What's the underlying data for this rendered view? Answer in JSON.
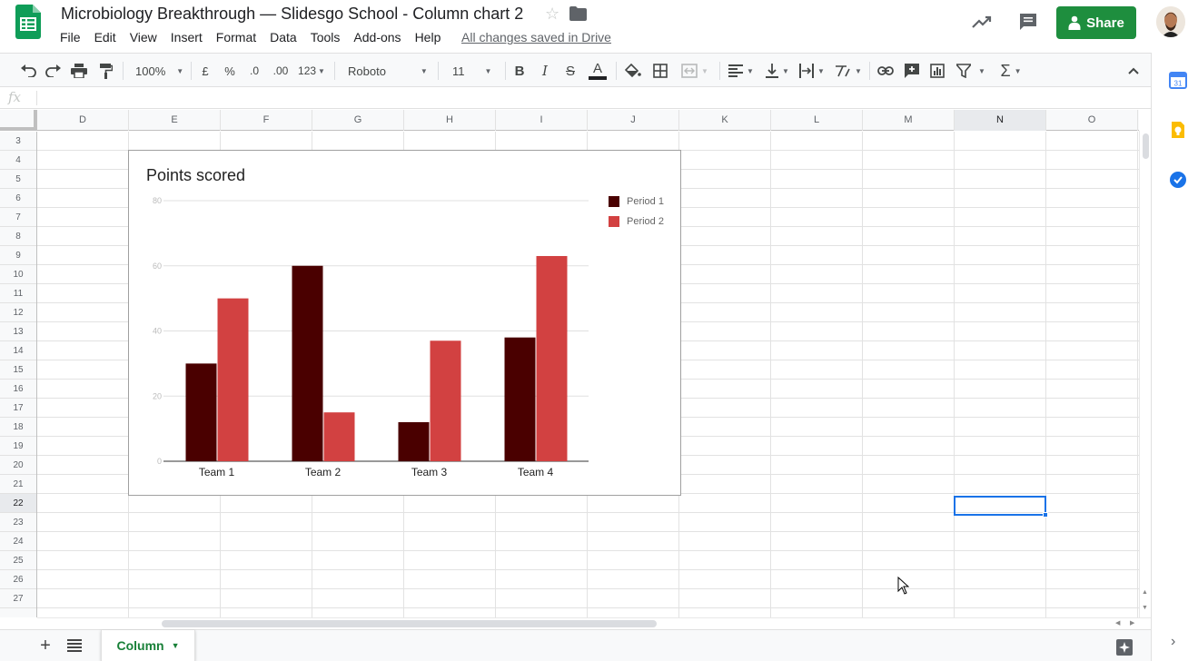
{
  "header": {
    "title": "Microbiology Breakthrough — Slidesgo School - Column chart 2",
    "menus": [
      "File",
      "Edit",
      "View",
      "Insert",
      "Format",
      "Data",
      "Tools",
      "Add-ons",
      "Help"
    ],
    "saved_status": "All changes saved in Drive",
    "share_label": "Share"
  },
  "toolbar": {
    "zoom": "100%",
    "currency": "£",
    "percent": "%",
    "decrease_decimals": ".0",
    "increase_decimals": ".00",
    "more_formats": "123",
    "font": "Roboto",
    "font_size": "11",
    "bold": "B",
    "italic": "I",
    "strikethrough": "S",
    "text_color": "A"
  },
  "formula_bar": {
    "fx": "fx",
    "value": ""
  },
  "columns": [
    "D",
    "E",
    "F",
    "G",
    "H",
    "I",
    "J",
    "K",
    "L",
    "M",
    "N",
    "O"
  ],
  "selected_column": "N",
  "rows": [
    "3",
    "4",
    "5",
    "6",
    "7",
    "8",
    "9",
    "10",
    "11",
    "12",
    "13",
    "14",
    "15",
    "16",
    "17",
    "18",
    "19",
    "20",
    "21",
    "22",
    "23",
    "24",
    "25",
    "26",
    "27"
  ],
  "selected_row": "22",
  "chart_data": {
    "type": "bar",
    "title": "Points scored",
    "categories": [
      "Team 1",
      "Team 2",
      "Team 3",
      "Team 4"
    ],
    "series": [
      {
        "name": "Period 1",
        "values": [
          30,
          60,
          12,
          38
        ],
        "color": "#4a0000"
      },
      {
        "name": "Period 2",
        "values": [
          50,
          15,
          37,
          63
        ],
        "color": "#d24141"
      }
    ],
    "ylim": [
      0,
      80
    ],
    "yticks": [
      0,
      20,
      40,
      60,
      80
    ],
    "legend": "top-right",
    "grid": true
  },
  "sheet_tabs": [
    {
      "label": "Column",
      "active": true
    }
  ],
  "colors": {
    "brand_green": "#1e8e3e",
    "selection_blue": "#1a73e8",
    "tab_green": "#188038"
  }
}
